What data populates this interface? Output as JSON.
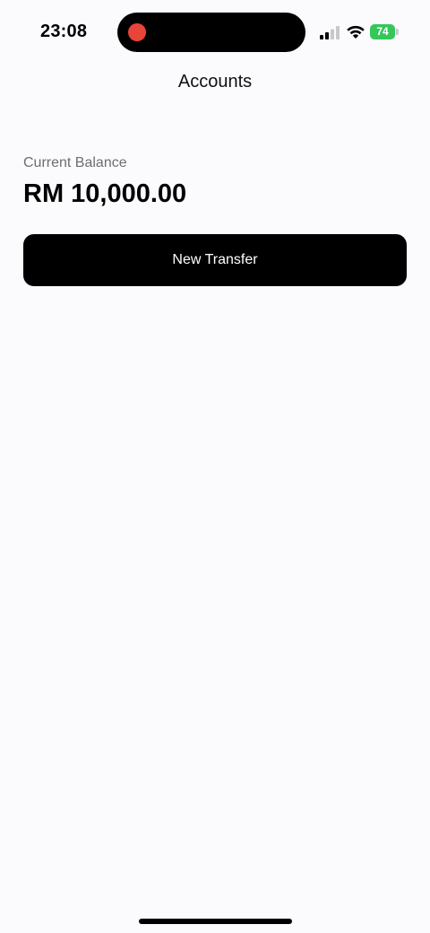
{
  "status_bar": {
    "time": "23:08",
    "battery_level": "74",
    "signal_icon": "signal-icon",
    "wifi_icon": "wifi-icon",
    "battery_icon": "battery-icon",
    "recording_indicator_color": "#e9443a",
    "battery_color": "#34c759"
  },
  "nav": {
    "title": "Accounts"
  },
  "balance": {
    "label": "Current Balance",
    "value": "RM 10,000.00"
  },
  "actions": {
    "new_transfer_label": "New Transfer"
  }
}
